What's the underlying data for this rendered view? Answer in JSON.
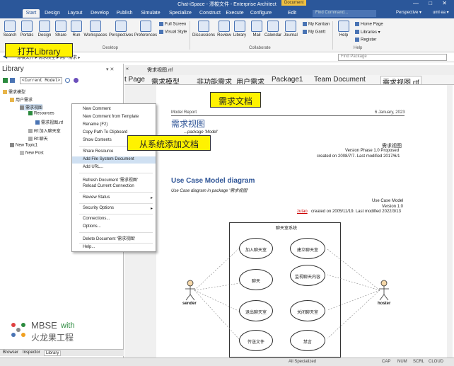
{
  "titlebar": {
    "title": "Chat-iSpace - 漂梭文件 - Enterprise Architect",
    "document_tag": "Document",
    "controls": "—  □  ✕"
  },
  "ribbon_tabs": [
    "Start",
    "Design",
    "Layout",
    "Develop",
    "Publish",
    "Simulate",
    "Specialize",
    "Construct",
    "Execute",
    "Configure",
    "Edit"
  ],
  "find_command": "Find Command...",
  "perspective": "Perspective ▾",
  "user": "uml ea ▾",
  "ribbon": {
    "buttons": [
      "Search",
      "Portals",
      "Design",
      "Share",
      "Run",
      "Workspaces",
      "Perspectives",
      "Preferences",
      "Discussions",
      "Review",
      "Library",
      "Mail",
      "Calendar",
      "Journal",
      "Help"
    ],
    "small": [
      "Full Screen",
      "Visual Style",
      "My Kanban",
      "My Gantt",
      "Home Page",
      "Libraries ▾",
      "Register"
    ],
    "groups": [
      "Desktop",
      "Collaborate",
      "Help"
    ]
  },
  "breadcrumb": "漂梭文件 ▸ 需求模型 ▸ 用户需求 ▸",
  "find_package": "Find Package",
  "library": {
    "title": "Library",
    "model_select": "<Current Model>",
    "tree": [
      "需求模型",
      "用户需求",
      "需求视图",
      "Resources",
      "需求视图.rtf",
      "Rf:加入聊天室",
      "Rf:聊天",
      "New Topic1",
      "New Post"
    ],
    "bottom_tabs": [
      "Browser",
      "Inspector",
      "Library"
    ]
  },
  "context_menu": [
    "New Comment",
    "New Comment from Template",
    "Rename (F2)",
    "Copy Path To Clipboard",
    "Show Contents",
    "Share Resource",
    "Add File System Document",
    "Add URL...",
    "Refresh Document '需求视图'",
    "Reload Current Connection",
    "Review Status",
    "Security Options",
    "Connections...",
    "Options...",
    "Delete Document '需求视图'",
    "Help..."
  ],
  "doc_tabs": [
    "t Page",
    "需求模型",
    "非功能需求",
    "用户需求",
    "Package1",
    "Team Document",
    "需求视图.rtf"
  ],
  "sub_header": "需求视图.rtf",
  "document": {
    "header_left": "Model Report",
    "header_right": "6 January, 2023",
    "title": "需求视图",
    "subtitle": "...package 'Model'",
    "meta_name": "需求视图",
    "meta_version": "Version   Phase 1.0   Proposed",
    "meta_created": "created on 2008/7/7.  Last modified 2017/6/1",
    "section_title": "Use Case Model diagram",
    "section_sub": "Use Case diagram in package '需求视图'",
    "uc_meta1": "Use Case Model",
    "uc_meta2": "Version 1.0",
    "uc_author": "zutao",
    "uc_meta3": "created on 2005/11/19.  Last modified 2022/3/13",
    "boundary": "聊天室系统",
    "actors": [
      "sender",
      "hoster"
    ],
    "usecases": [
      "加入聊天室",
      "建立聊天室",
      "聊天",
      "监视聊天内容",
      "退出聊天室",
      "关闭聊天室",
      "传送文件",
      "禁言"
    ]
  },
  "callouts": [
    "打开Library",
    "需求文档",
    "从系统添加文档"
  ],
  "logo": {
    "text1": "MBSE",
    "text2": "with",
    "text3": "火龙果工程"
  },
  "status": {
    "mode": "All Specialized",
    "keys": [
      "CAP",
      "NUM",
      "SCRL",
      "CLOUD"
    ]
  }
}
